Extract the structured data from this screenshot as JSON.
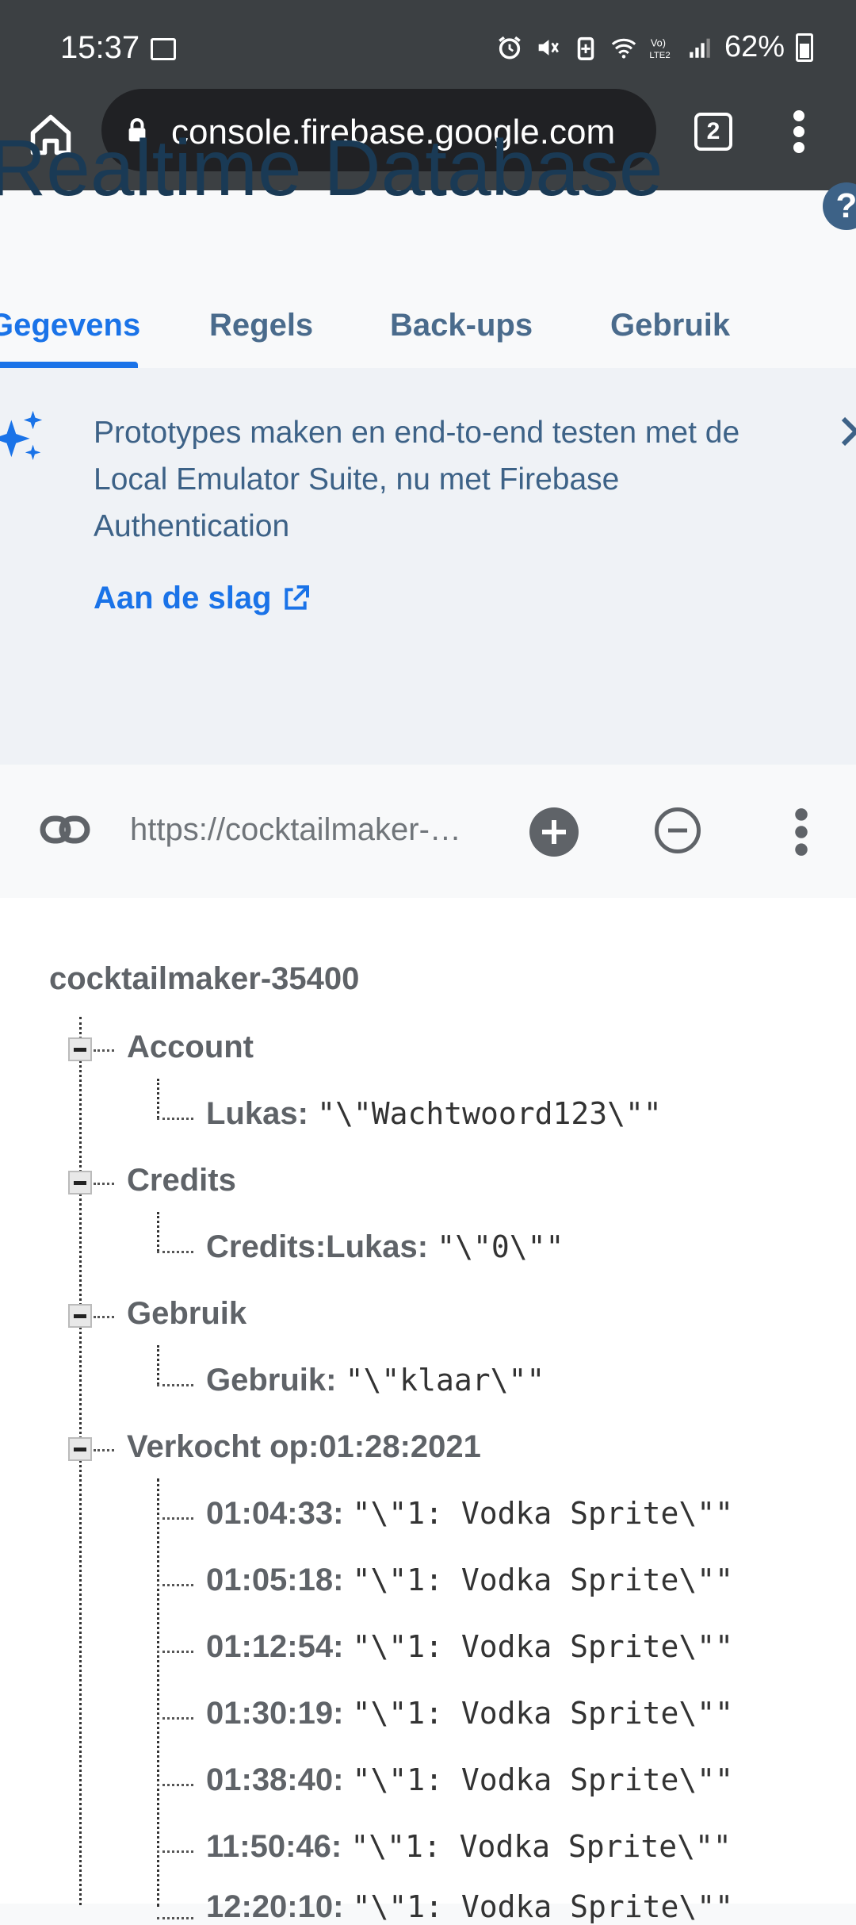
{
  "status_bar": {
    "time": "15:37",
    "battery": "62%"
  },
  "browser": {
    "url": "console.firebase.google.com",
    "tab_count": "2"
  },
  "page": {
    "title": "Realtime Database",
    "help": "?"
  },
  "tabs": [
    {
      "label": "Gegevens"
    },
    {
      "label": "Regels"
    },
    {
      "label": "Back-ups"
    },
    {
      "label": "Gebruik"
    }
  ],
  "banner": {
    "text": "Prototypes maken en end-to-end testen met de Local Emulator Suite, nu met Firebase Authentication",
    "link": "Aan de slag"
  },
  "db_toolbar": {
    "url": "https://cocktailmaker-35400-default-rtdb.firebaseio.com/"
  },
  "tree": {
    "root": "cocktailmaker-35400",
    "nodes": [
      {
        "key": "Account",
        "children": [
          {
            "key": "Lukas:",
            "value": "\"\\\"Wachtwoord123\\\"\""
          }
        ]
      },
      {
        "key": "Credits",
        "children": [
          {
            "key": "Credits:Lukas:",
            "value": "\"\\\"0\\\"\""
          }
        ]
      },
      {
        "key": "Gebruik",
        "children": [
          {
            "key": "Gebruik:",
            "value": "\"\\\"klaar\\\"\""
          }
        ]
      },
      {
        "key": "Verkocht op:01:28:2021",
        "children": [
          {
            "key": "01:04:33:",
            "value": "\"\\\"1: Vodka Sprite\\\"\""
          },
          {
            "key": "01:05:18:",
            "value": "\"\\\"1: Vodka Sprite\\\"\""
          },
          {
            "key": "01:12:54:",
            "value": "\"\\\"1: Vodka Sprite\\\"\""
          },
          {
            "key": "01:30:19:",
            "value": "\"\\\"1: Vodka Sprite\\\"\""
          },
          {
            "key": "01:38:40:",
            "value": "\"\\\"1: Vodka Sprite\\\"\""
          },
          {
            "key": "11:50:46:",
            "value": "\"\\\"1: Vodka Sprite\\\"\""
          },
          {
            "key": "12:20:10:",
            "value": "\"\\\"1: Vodka Sprite\\\"\""
          }
        ]
      }
    ]
  }
}
